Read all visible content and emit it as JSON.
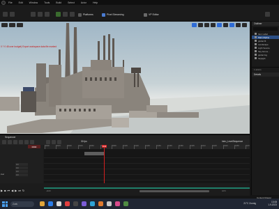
{
  "menu": {
    "items": [
      "File",
      "Edit",
      "Window",
      "Tools",
      "Build",
      "Select",
      "Actor",
      "Help"
    ]
  },
  "toolbar": {
    "platforms_label": "Platforms",
    "pixel_streaming_label": "Pixel Streaming",
    "vr_preview_label": "VP Editor"
  },
  "viewport": {
    "warning_text": "0 ? 0 48 over budget) Export workspace data file marked"
  },
  "outliner": {
    "title": "Outliner",
    "items": [
      {
        "label": "Item Label",
        "selected": false
      },
      {
        "label": "Main Zipline",
        "selected": true
      },
      {
        "label": "global fft",
        "selected": false
      },
      {
        "label": "Landscape",
        "selected": false
      },
      {
        "label": "Light Source",
        "selected": false
      },
      {
        "label": "Sky Atmos...",
        "selected": false
      },
      {
        "label": "global fog",
        "selected": false
      },
      {
        "label": "Skylight",
        "selected": false
      }
    ],
    "count": "1 actors",
    "details_title": "Details"
  },
  "sequencer": {
    "tab_label": "Sequencer",
    "fps": "30 fps",
    "sequence_name": "Intro_LevelSequence",
    "current_time": "0000",
    "playhead_label": "0040",
    "ruler_labels": [
      "0000",
      "0015",
      "0030",
      "0045",
      "0060",
      "0075",
      "0090",
      "0105",
      "0120",
      "0135",
      "0150",
      "0165",
      "0180",
      "0195",
      "0210",
      "0225",
      "0240",
      "0255",
      "0270"
    ],
    "track_label": "inal",
    "value_rows": [
      "0.0",
      "0.0",
      "0.0",
      "0.0"
    ],
    "range_start": "-0015",
    "range_end": "0150",
    "range_right": "0270"
  },
  "status": {
    "content_label": "Content Drawer"
  },
  "taskbar": {
    "search_placeholder": "Zoek",
    "weather": "21°C  Zonnig",
    "time": "13:08",
    "date": "1-9-2023"
  }
}
